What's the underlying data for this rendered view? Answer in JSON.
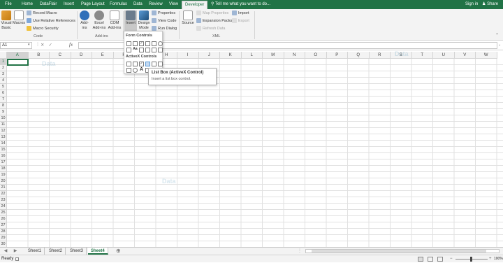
{
  "tabs": [
    {
      "label": "File"
    },
    {
      "label": "Home"
    },
    {
      "label": "DataFlair"
    },
    {
      "label": "Insert"
    },
    {
      "label": "Page Layout"
    },
    {
      "label": "Formulas"
    },
    {
      "label": "Data"
    },
    {
      "label": "Review"
    },
    {
      "label": "View"
    },
    {
      "label": "Developer"
    }
  ],
  "tell_me": "Tell me what you want to do...",
  "sign_in": "Sign in",
  "share": "Share",
  "ribbon": {
    "code": {
      "visual_basic": "Visual Basic",
      "macros": "Macros",
      "record_macro": "Record Macro",
      "relative_refs": "Use Relative References",
      "macro_security": "Macro Security",
      "label": "Code"
    },
    "addins": {
      "addins": "Add-ins",
      "excel_addins": "Excel Add-ins",
      "com_addins": "COM Add-ins",
      "label": "Add-ins"
    },
    "controls": {
      "insert": "Insert",
      "design_mode": "Design Mode",
      "properties": "Properties",
      "view_code": "View Code",
      "run_dialog": "Run Dialog"
    },
    "xml": {
      "source": "Source",
      "map_properties": "Map Properties",
      "expansion_packs": "Expansion Packs",
      "refresh_data": "Refresh Data",
      "import": "Import",
      "export": "Export",
      "label": "XML"
    }
  },
  "insert_menu": {
    "form_controls": "Form Controls",
    "activex_controls": "ActiveX Controls"
  },
  "tooltip": {
    "title": "List Box (ActiveX Control)",
    "desc": "Insert a list box control."
  },
  "name_box": "A1",
  "fx": "fx",
  "columns": [
    "A",
    "B",
    "C",
    "D",
    "E",
    "F",
    "G",
    "H",
    "I",
    "J",
    "K",
    "L",
    "M",
    "N",
    "O",
    "P",
    "Q",
    "R",
    "S",
    "T",
    "U",
    "V",
    "W"
  ],
  "rows": [
    "1",
    "2",
    "3",
    "4",
    "5",
    "6",
    "7",
    "8",
    "9",
    "10",
    "11",
    "12",
    "13",
    "14",
    "15",
    "16",
    "17",
    "18",
    "19",
    "20",
    "21",
    "22",
    "23",
    "24",
    "25",
    "26",
    "27",
    "28",
    "29",
    "30"
  ],
  "sheets": [
    {
      "label": "Sheet1"
    },
    {
      "label": "Sheet2"
    },
    {
      "label": "Sheet3"
    },
    {
      "label": "Sheet4"
    }
  ],
  "active_sheet": "Sheet4",
  "status": "Ready",
  "zoom": "100%",
  "watermark": {
    "text": "Data",
    "sub": "Flair"
  },
  "colors": {
    "accent": "#217346"
  }
}
